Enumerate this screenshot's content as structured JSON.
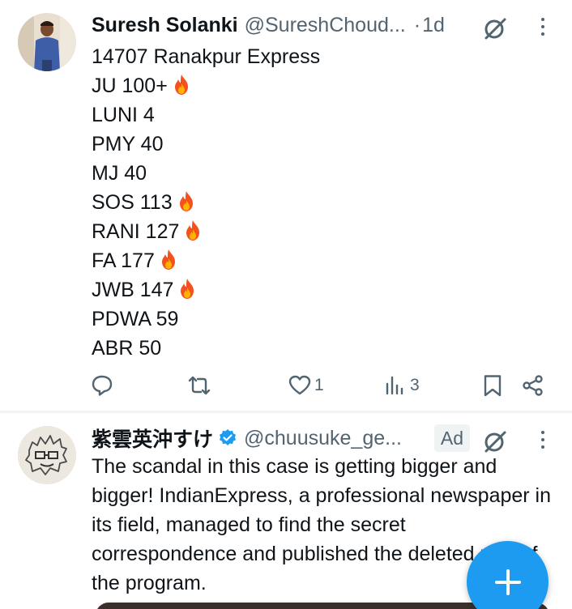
{
  "tweet1": {
    "display_name": "Suresh Solanki",
    "handle": "@SureshChoud...",
    "separator": "·",
    "time": "1d",
    "lines": [
      {
        "text": "14707 Ranakpur Express",
        "fire": false
      },
      {
        "text": "JU 100+",
        "fire": true
      },
      {
        "text": "LUNI 4",
        "fire": false
      },
      {
        "text": "PMY 40",
        "fire": false
      },
      {
        "text": "MJ 40",
        "fire": false
      },
      {
        "text": "SOS 113",
        "fire": true
      },
      {
        "text": "RANI 127",
        "fire": true
      },
      {
        "text": "FA 177",
        "fire": true
      },
      {
        "text": "JWB 147",
        "fire": true
      },
      {
        "text": "PDWA 59",
        "fire": false
      },
      {
        "text": "ABR 50",
        "fire": false
      }
    ],
    "actions": {
      "reply_icon": "reply-icon",
      "retweet_icon": "retweet-icon",
      "like_icon": "heart-icon",
      "like_count": "1",
      "views_icon": "views-icon",
      "views_count": "3",
      "bookmark_icon": "bookmark-icon",
      "share_icon": "share-icon"
    }
  },
  "tweet2": {
    "display_name": "紫雲英沖すけ",
    "handle": "@chuusuke_ge...",
    "ad_label": "Ad",
    "text": "The scandal in this case is getting bigger and bigger!  IndianExpress, a professional newspaper in its field, managed to find the secret correspondence and published the deleted part of the program."
  },
  "icons": {
    "grok": "grok-icon",
    "more": "more-icon",
    "verified": "verified-badge-icon",
    "compose": "plus-icon"
  },
  "colors": {
    "accent": "#1d9bf0",
    "secondary_text": "#536471",
    "primary_text": "#0f1419",
    "divider": "#eff3f4"
  }
}
